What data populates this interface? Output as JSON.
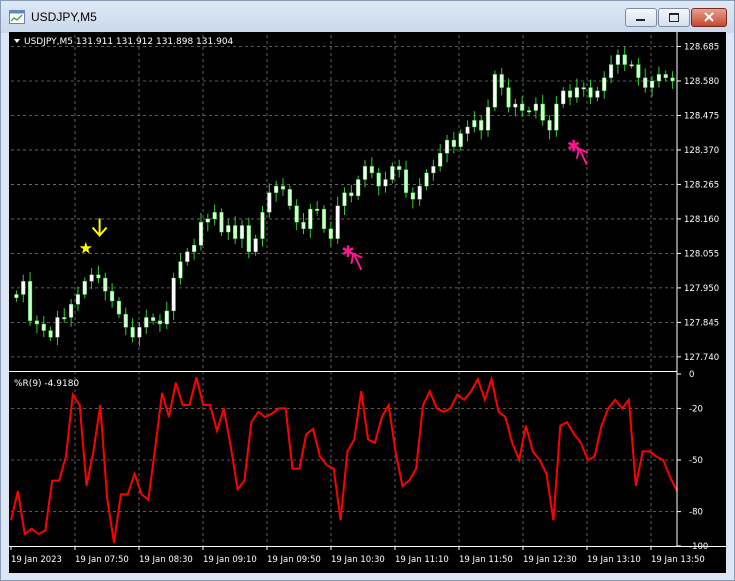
{
  "window": {
    "title": "USDJPY,M5",
    "app_icon": "chart-window-icon",
    "controls": [
      "minimize-icon",
      "maximize-icon",
      "close-icon"
    ]
  },
  "chart": {
    "header": "USDJPY,M5  131.911 131.912 131.898 131.904",
    "indicator_label": "%R(9) -4.9180",
    "colors": {
      "background": "#000000",
      "candle_bull": "#ffffff",
      "candle_bear": "#ccffcc",
      "wick": "#33cc33",
      "grid": "#777777",
      "wpr_line": "#ff0000",
      "buy_arrow": "#ff1493",
      "sell_arrow": "#ffff00"
    }
  },
  "chart_data": [
    {
      "type": "candlestick",
      "title": "USDJPY,M5",
      "ylim": [
        127.7,
        128.72
      ],
      "price_ticks": [
        "128.685",
        "128.580",
        "128.475",
        "128.370",
        "128.265",
        "128.160",
        "128.055",
        "127.950",
        "127.845",
        "127.740"
      ],
      "time_labels": [
        "19 Jan 2023",
        "19 Jan 07:50",
        "19 Jan 08:30",
        "19 Jan 09:10",
        "19 Jan 09:50",
        "19 Jan 10:30",
        "19 Jan 11:10",
        "19 Jan 11:50",
        "19 Jan 12:30",
        "19 Jan 13:10",
        "19 Jan 13:50"
      ],
      "close": [
        127.93,
        127.97,
        127.85,
        127.84,
        127.82,
        127.8,
        127.86,
        127.86,
        127.9,
        127.93,
        127.97,
        127.99,
        127.98,
        127.94,
        127.91,
        127.87,
        127.83,
        127.8,
        127.83,
        127.86,
        127.85,
        127.84,
        127.88,
        127.98,
        128.03,
        128.06,
        128.08,
        128.15,
        128.16,
        128.18,
        128.12,
        128.14,
        128.1,
        128.14,
        128.06,
        128.1,
        128.18,
        128.24,
        128.26,
        128.25,
        128.2,
        128.15,
        128.13,
        128.19,
        128.19,
        128.13,
        128.1,
        128.2,
        128.24,
        128.23,
        128.28,
        128.32,
        128.3,
        128.26,
        128.28,
        128.32,
        128.31,
        128.24,
        128.22,
        128.26,
        128.3,
        128.32,
        128.36,
        128.4,
        128.38,
        128.42,
        128.44,
        128.46,
        128.43,
        128.5,
        128.6,
        128.56,
        128.5,
        128.51,
        128.49,
        128.49,
        128.51,
        128.46,
        128.43,
        128.51,
        128.55,
        128.53,
        128.56,
        128.56,
        128.53,
        128.55,
        128.59,
        128.63,
        128.66,
        128.63,
        128.63,
        128.59,
        128.56,
        128.58,
        128.6,
        128.59,
        128.58
      ],
      "markers": [
        {
          "type": "sell",
          "index": 11,
          "price": 128.07
        },
        {
          "type": "buy",
          "index": 49,
          "price": 128.06
        },
        {
          "type": "buy",
          "index": 82,
          "price": 128.38
        }
      ]
    },
    {
      "type": "line",
      "title": "%R(9) -4.9180",
      "ylim": [
        -100,
        0
      ],
      "ticks": [
        "0",
        "-20",
        "-50",
        "-80",
        "-100"
      ],
      "series": [
        {
          "values": [
            -85,
            -68,
            -93,
            -90,
            -93,
            -91,
            -62,
            -62,
            -48,
            -12,
            -18,
            -65,
            -45,
            -18,
            -72,
            -98,
            -70,
            -70,
            -58,
            -70,
            -73,
            -43,
            -11,
            -25,
            -5,
            -18,
            -18,
            -2,
            -18,
            -18,
            -33,
            -20,
            -42,
            -67,
            -62,
            -28,
            -22,
            -25,
            -23,
            -20,
            -20,
            -55,
            -55,
            -35,
            -32,
            -48,
            -53,
            -55,
            -85,
            -45,
            -38,
            -10,
            -38,
            -40,
            -25,
            -18,
            -45,
            -65,
            -62,
            -55,
            -18,
            -10,
            -20,
            -22,
            -20,
            -12,
            -15,
            -10,
            -3,
            -15,
            -3,
            -22,
            -25,
            -40,
            -50,
            -30,
            -45,
            -50,
            -58,
            -85,
            -30,
            -28,
            -35,
            -40,
            -50,
            -48,
            -30,
            -20,
            -15,
            -20,
            -15,
            -65,
            -45,
            -45,
            -48,
            -50,
            -60,
            -68
          ]
        }
      ]
    }
  ]
}
